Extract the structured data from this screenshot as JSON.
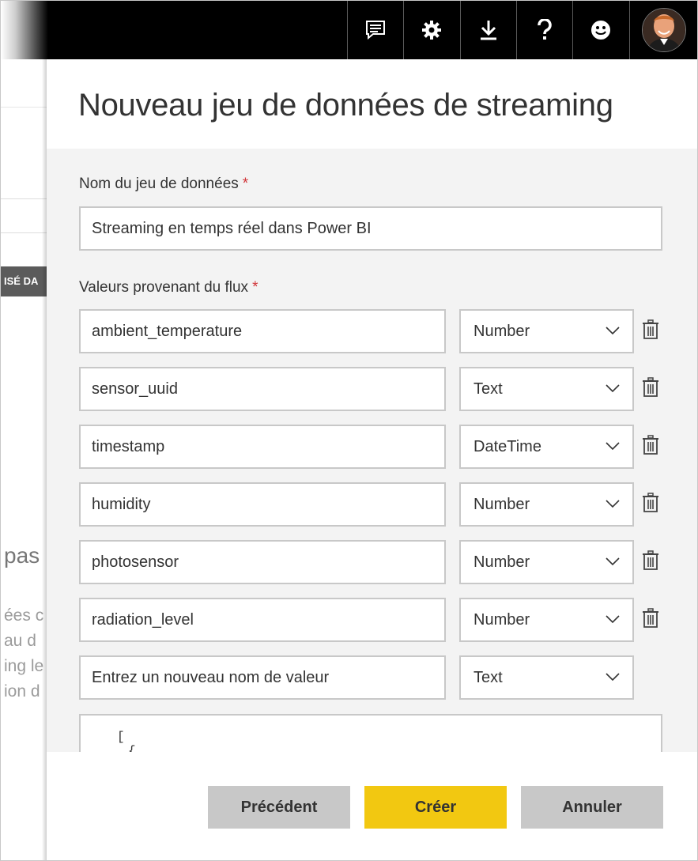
{
  "topbar": {
    "icons": [
      "feedback-icon",
      "gear-icon",
      "download-icon",
      "help-icon",
      "smiley-icon"
    ],
    "colors": {
      "background": "#000000",
      "icon": "#ffffff"
    }
  },
  "background_page": {
    "dark_strip_text": "ISÉ DA",
    "heading_fragment": "pas",
    "text_fragments": [
      "ées c",
      "au d",
      "ing le",
      "ion d"
    ]
  },
  "dialog": {
    "title": "Nouveau jeu de données de streaming",
    "dataset_name_label": "Nom du jeu de données",
    "required_mark": "*",
    "dataset_name_value": "Streaming en temps réel dans Power BI",
    "values_label": "Valeurs provenant du flux",
    "fields": [
      {
        "name": "ambient_temperature",
        "type": "Number"
      },
      {
        "name": "sensor_uuid",
        "type": "Text"
      },
      {
        "name": "timestamp",
        "type": "DateTime"
      },
      {
        "name": "humidity",
        "type": "Number"
      },
      {
        "name": "photosensor",
        "type": "Number"
      },
      {
        "name": "radiation_level",
        "type": "Number"
      }
    ],
    "new_field_placeholder": "Entrez un nouveau nom de valeur",
    "new_field_type": "Text",
    "json_preview": [
      "[",
      "{"
    ],
    "buttons": {
      "previous": "Précédent",
      "create": "Créer",
      "cancel": "Annuler"
    },
    "colors": {
      "create_button": "#f2c811",
      "secondary_button": "#c8c8c8",
      "required": "#d13438"
    }
  }
}
